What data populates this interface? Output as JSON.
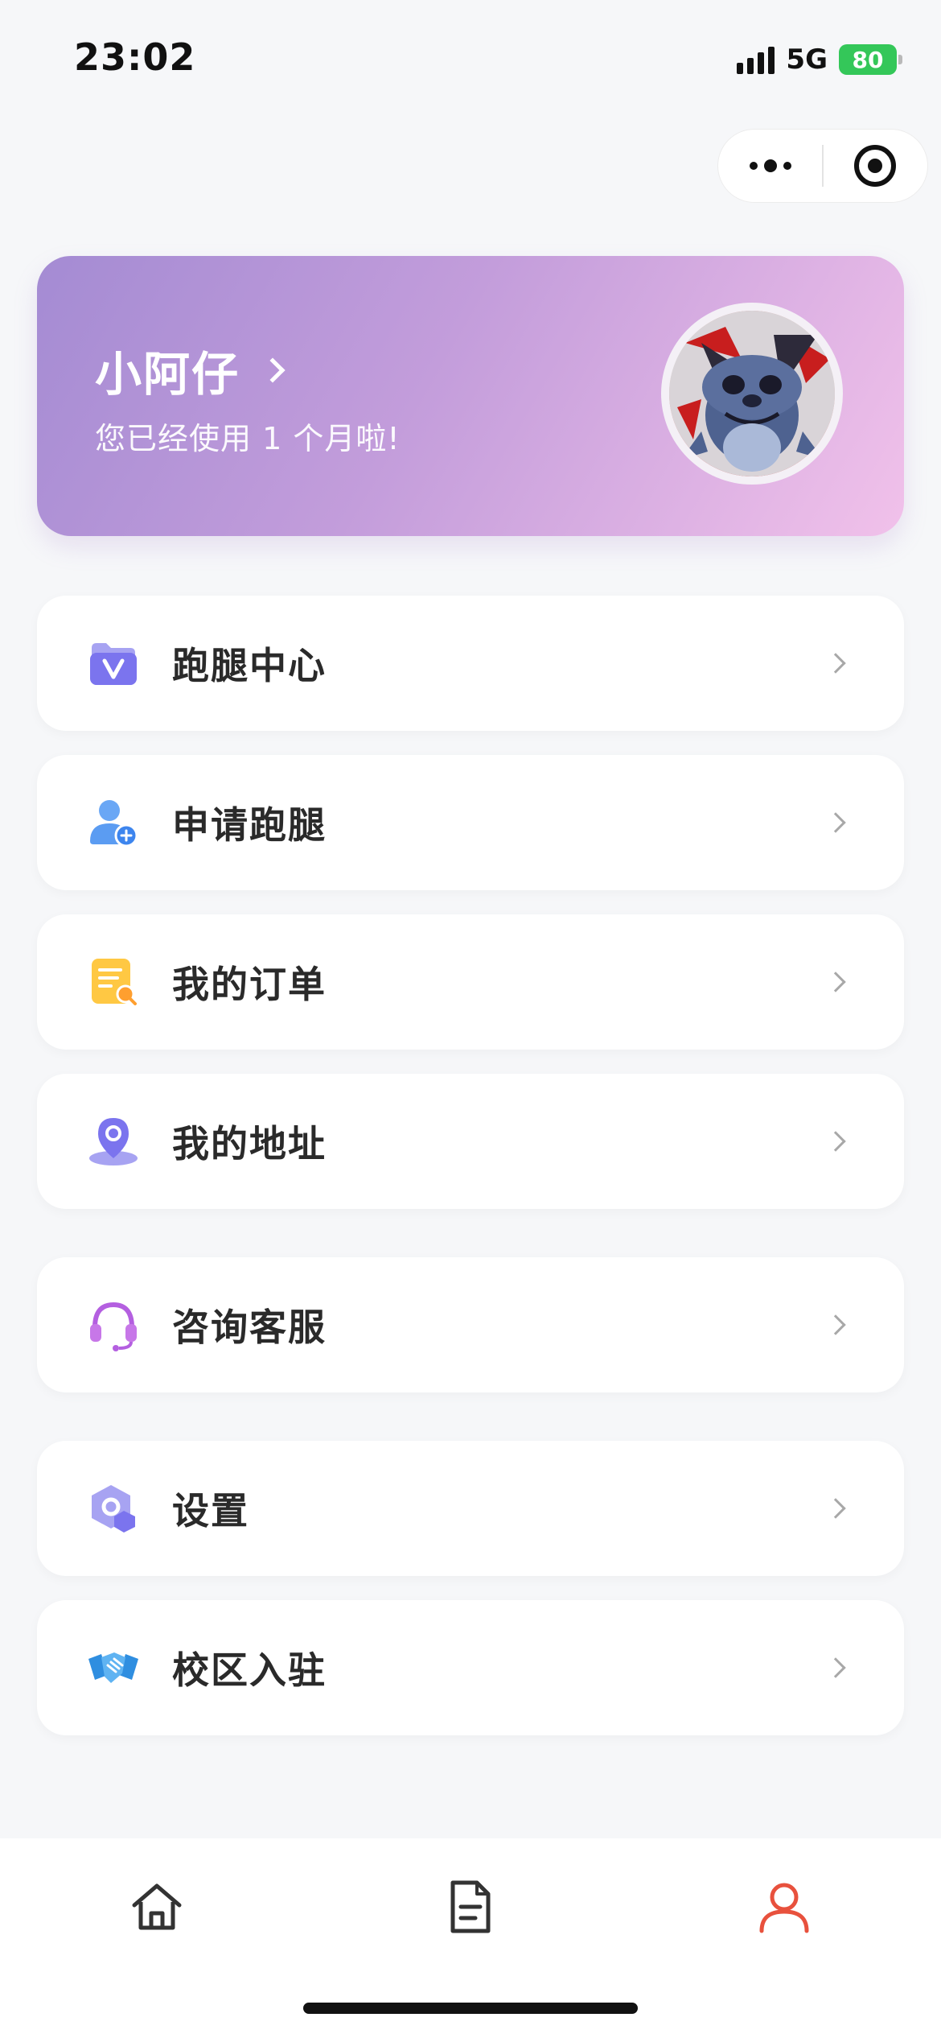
{
  "status_bar": {
    "time": "23:02",
    "network": "5G",
    "battery": "80"
  },
  "profile": {
    "name": "小阿仔",
    "subtitle": "您已经使用 1 个月啦!"
  },
  "menu": [
    {
      "label": "跑腿中心",
      "icon": "v-badge-icon"
    },
    {
      "label": "申请跑腿",
      "icon": "user-add-icon"
    },
    {
      "label": "我的订单",
      "icon": "order-document-icon"
    },
    {
      "label": "我的地址",
      "icon": "location-pin-icon"
    },
    {
      "label": "咨询客服",
      "icon": "headset-icon"
    },
    {
      "label": "设置",
      "icon": "settings-hex-icon"
    },
    {
      "label": "校区入驻",
      "icon": "handshake-icon"
    }
  ],
  "bottom_nav": [
    {
      "name": "home",
      "icon": "home-icon",
      "active": false
    },
    {
      "name": "orders",
      "icon": "document-icon",
      "active": false
    },
    {
      "name": "profile",
      "icon": "user-icon",
      "active": true
    }
  ],
  "colors": {
    "active_tab": "#e8513d",
    "card_gradient_start": "#a48bd3",
    "card_gradient_end": "#f1c1ea",
    "battery": "#34c759"
  }
}
